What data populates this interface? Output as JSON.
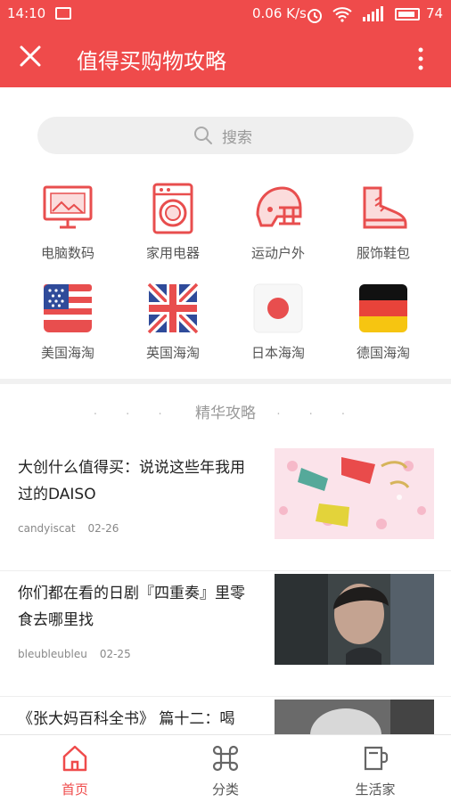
{
  "status_bar": {
    "time": "14:10",
    "speed": "0.06 K/s",
    "battery": "74"
  },
  "app_bar": {
    "title": "值得买购物攻略"
  },
  "search": {
    "placeholder": "搜索"
  },
  "categories": [
    {
      "label": "电脑数码",
      "icon": "monitor-icon"
    },
    {
      "label": "家用电器",
      "icon": "washing-machine-icon"
    },
    {
      "label": "运动户外",
      "icon": "helmet-icon"
    },
    {
      "label": "服饰鞋包",
      "icon": "sneaker-icon"
    },
    {
      "label": "美国海淘",
      "icon": "us-flag-icon"
    },
    {
      "label": "英国海淘",
      "icon": "uk-flag-icon"
    },
    {
      "label": "日本海淘",
      "icon": "japan-flag-icon"
    },
    {
      "label": "德国海淘",
      "icon": "germany-flag-icon"
    }
  ],
  "featured": {
    "title": "精华攻略",
    "articles": [
      {
        "title": "大创什么值得买：说说这些年我用过的DAISO",
        "author": "candyiscat",
        "date": "02-26"
      },
      {
        "title": "你们都在看的日剧『四重奏』里零食去哪里找",
        "author": "bleubleubleu",
        "date": "02-25"
      },
      {
        "title": "《张大妈百科全书》 篇十二：喝",
        "author": "",
        "date": ""
      }
    ]
  },
  "tabs": [
    {
      "label": "首页",
      "icon": "home-icon",
      "active": true
    },
    {
      "label": "分类",
      "icon": "command-icon",
      "active": false
    },
    {
      "label": "生活家",
      "icon": "mug-icon",
      "active": false
    }
  ],
  "colors": {
    "brand": "#ef4b4b",
    "text": "#222222",
    "muted": "#999999"
  }
}
